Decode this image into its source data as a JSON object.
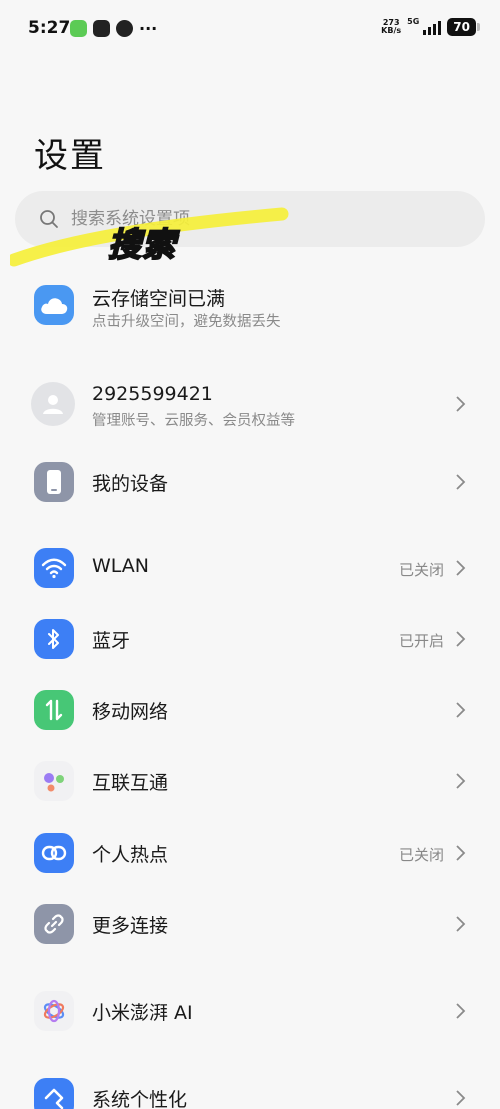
{
  "status_bar": {
    "time": "5:27",
    "more": "···",
    "speed_value": "273",
    "speed_unit": "KB/s",
    "network": "5G",
    "battery": "70"
  },
  "header": {
    "title": "设置"
  },
  "search": {
    "placeholder": "搜索系统设置项"
  },
  "annotation": {
    "text": "搜索",
    "stroke_color": "#f5ef3a"
  },
  "cloud": {
    "title": "云存储空间已满",
    "subtitle": "点击升级空间，避免数据丢失"
  },
  "account": {
    "title": "2925599421",
    "subtitle": "管理账号、云服务、会员权益等"
  },
  "items": [
    {
      "label": "我的设备",
      "status": ""
    },
    {
      "label": "WLAN",
      "status": "已关闭"
    },
    {
      "label": "蓝牙",
      "status": "已开启"
    },
    {
      "label": "移动网络",
      "status": ""
    },
    {
      "label": "互联互通",
      "status": ""
    },
    {
      "label": "个人热点",
      "status": "已关闭"
    },
    {
      "label": "更多连接",
      "status": ""
    },
    {
      "label": "小米澎湃 AI",
      "status": ""
    },
    {
      "label": "系统个性化",
      "status": ""
    }
  ],
  "colors": {
    "blue": "#3d7ff5",
    "green": "#47c776",
    "gray_icon": "#8e95a8",
    "cloud": "#4a98f2"
  }
}
